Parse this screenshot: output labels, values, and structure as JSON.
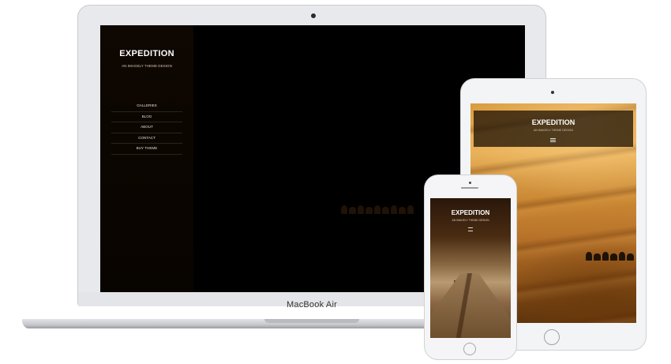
{
  "laptop": {
    "brand": "MacBook Air",
    "site_title": "EXPEDITION",
    "site_subtitle": "AN IMAGELY THEME DESIGN",
    "nav": [
      "GALLERIES",
      "BLOG",
      "ABOUT",
      "CONTACT",
      "BUY THEME"
    ]
  },
  "tablet": {
    "site_title": "EXPEDITION",
    "site_subtitle": "AN IMAGELY THEME DESIGN",
    "menu_icon": "hamburger-icon"
  },
  "phone": {
    "site_title": "EXPEDITION",
    "site_subtitle": "AN IMAGELY THEME DESIGN",
    "menu_icon": "hamburger-icon"
  }
}
